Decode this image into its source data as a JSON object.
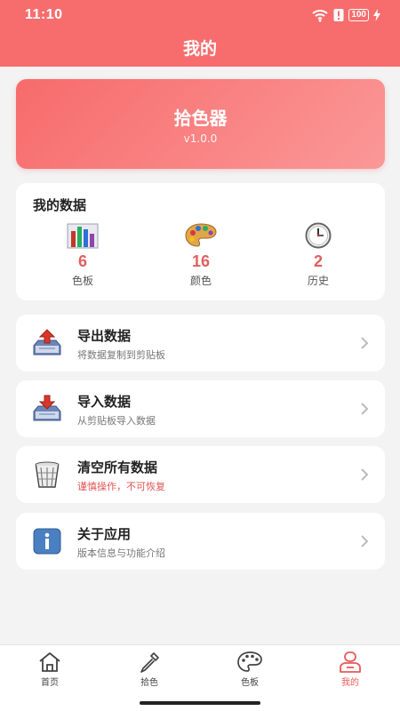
{
  "status_bar": {
    "time": "11:10",
    "battery": "100"
  },
  "header": {
    "title": "我的"
  },
  "hero": {
    "app_name": "拾色器",
    "version": "v1.0.0"
  },
  "stats": {
    "title": "我的数据",
    "items": [
      {
        "icon": "bar-chart-icon",
        "value": "6",
        "label": "色板"
      },
      {
        "icon": "palette-icon",
        "value": "16",
        "label": "颜色"
      },
      {
        "icon": "clock-icon",
        "value": "2",
        "label": "历史"
      }
    ]
  },
  "menu": [
    {
      "icon": "export-tray-icon",
      "title": "导出数据",
      "subtitle": "将数据复制到剪贴板"
    },
    {
      "icon": "import-tray-icon",
      "title": "导入数据",
      "subtitle": "从剪贴板导入数据"
    },
    {
      "icon": "trash-icon",
      "title": "清空所有数据",
      "subtitle": "谨慎操作，不可恢复",
      "warning_color": "#e05555"
    },
    {
      "icon": "info-icon",
      "title": "关于应用",
      "subtitle": "版本信息与功能介绍"
    }
  ],
  "tabs": [
    {
      "icon": "home-icon",
      "label": "首页",
      "active": false
    },
    {
      "icon": "eyedropper-icon",
      "label": "拾色",
      "active": false
    },
    {
      "icon": "palette-icon",
      "label": "色板",
      "active": false
    },
    {
      "icon": "user-icon",
      "label": "我的",
      "active": true
    }
  ],
  "colors": {
    "accent": "#f76d6d",
    "active_tab": "#e85a5a",
    "stat_value": "#e06060"
  }
}
